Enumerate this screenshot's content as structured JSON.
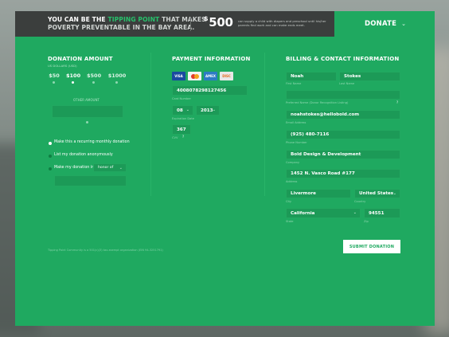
{
  "header": {
    "tagline_part1": "YOU CAN BE THE",
    "tagline_highlight": "TIPPING POINT",
    "tagline_part2": "THAT MAKES",
    "tagline_line2_a": "POVERTY PREVENTABLE",
    "tagline_line2_b": "IN THE BAY AREA.",
    "currency": "$",
    "amount": "500",
    "amount_description": "can supply a child with diapers and preschool until his/her parents find work and can make ends meet.",
    "donate_label": "DONATE",
    "donate_chevron": "chevron-down-icon"
  },
  "donation": {
    "title": "DONATION AMOUNT",
    "subtitle": "US DOLLARS (USD)",
    "amounts": [
      "$50",
      "$100",
      "$500",
      "$1000"
    ],
    "selected_index": 1,
    "other_label": "OTHER AMOUNT",
    "other_value": "",
    "options": [
      {
        "label": "Make this a recurring monthly donation",
        "selected": true
      },
      {
        "label": "List my donation anonymously",
        "selected": false
      },
      {
        "label": "Make my donation in",
        "selected": false
      }
    ],
    "tribute_select": "honor of",
    "tribute_value": ""
  },
  "payment": {
    "title": "PAYMENT INFORMATION",
    "cards": [
      {
        "name": "VISA",
        "color": "#1a4aa0"
      },
      {
        "name": "MC",
        "color": "#e23a2a"
      },
      {
        "name": "AMEX",
        "color": "#2d7bc4"
      },
      {
        "name": "DISC",
        "color": "#e8e8e8"
      }
    ],
    "card_number": "4008078298127456",
    "card_number_label": "Card Number",
    "exp_month": "08",
    "exp_year": "2013",
    "exp_label": "Expiration Date",
    "cvv": "367",
    "cvv_label": "CVV"
  },
  "billing": {
    "title": "BILLING & CONTACT INFORMATION",
    "first_name": "Noah",
    "first_name_label": "First Name",
    "last_name": "Stokes",
    "last_name_label": "Last Name",
    "preferred_name_label": "Preferred Name (Donor Recognition Listing)",
    "email": "noahstokes@hellobold.com",
    "email_label": "Email Address",
    "phone": "(925) 480-7116",
    "phone_label": "Phone Number",
    "company": "Bold Design & Development",
    "company_label": "Company",
    "address": "1452 N. Vasco Road #177",
    "address_label": "Address",
    "city": "Livermore",
    "city_label": "City",
    "country": "United States",
    "country_label": "Country",
    "state": "California",
    "state_label": "State",
    "zip": "94551",
    "zip_label": "Zip"
  },
  "submit_label": "SUBMIT DONATION",
  "footnote": "Tipping Point Community is a 501(c)(3) tax-exempt organization (EIN 94-3251791)"
}
